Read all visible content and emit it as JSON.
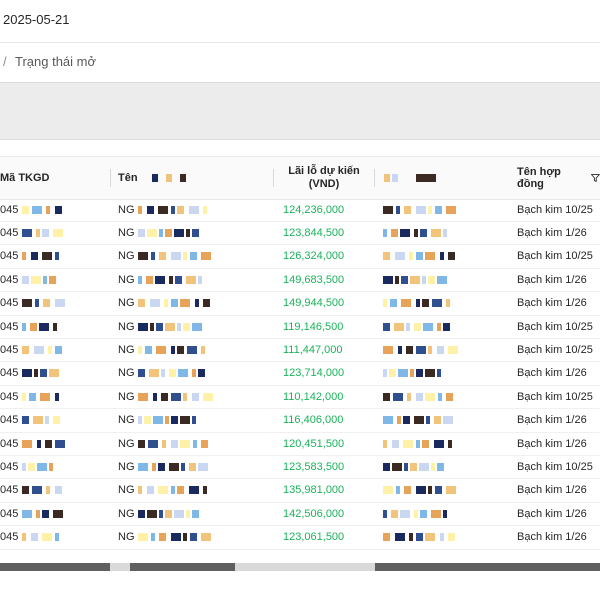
{
  "header": {
    "date": "2025-05-21"
  },
  "breadcrumb": {
    "separator": "/",
    "label": "Trạng thái mở"
  },
  "table": {
    "columns": {
      "code": "Mã TKGD",
      "name": "Tên",
      "pnl": "Lãi lỗ dự kiến (VND)",
      "contract": "Tên hợp đồng"
    },
    "rows": [
      {
        "code": "045",
        "name": "NG",
        "pnl": "124,236,000",
        "contract": "Bạch kim 10/25"
      },
      {
        "code": "045",
        "name": "NG",
        "pnl": "123,844,500",
        "contract": "Bạch kim 1/26"
      },
      {
        "code": "045",
        "name": "NG",
        "pnl": "126,324,000",
        "contract": "Bạch kim 10/25"
      },
      {
        "code": "045",
        "name": "NG",
        "pnl": "149,683,500",
        "contract": "Bạch kim 1/26"
      },
      {
        "code": "045",
        "name": "NG",
        "pnl": "149,944,500",
        "contract": "Bạch kim 1/26"
      },
      {
        "code": "045",
        "name": "NG",
        "pnl": "119,146,500",
        "contract": "Bạch kim 10/25"
      },
      {
        "code": "045",
        "name": "NG",
        "pnl": "111,447,000",
        "contract": "Bạch kim 10/25"
      },
      {
        "code": "045",
        "name": "NG",
        "pnl": "123,714,000",
        "contract": "Bạch kim 1/26"
      },
      {
        "code": "045",
        "name": "NG",
        "pnl": "110,142,000",
        "contract": "Bạch kim 10/25"
      },
      {
        "code": "045",
        "name": "NG",
        "pnl": "116,406,000",
        "contract": "Bạch kim 1/26"
      },
      {
        "code": "045",
        "name": "NG",
        "pnl": "120,451,500",
        "contract": "Bạch kim 1/26"
      },
      {
        "code": "045",
        "name": "NG",
        "pnl": "123,583,500",
        "contract": "Bạch kim 10/25"
      },
      {
        "code": "045",
        "name": "NG",
        "pnl": "135,981,000",
        "contract": "Bạch kim 1/26"
      },
      {
        "code": "045",
        "name": "NG",
        "pnl": "142,506,000",
        "contract": "Bạch kim 1/26"
      },
      {
        "code": "045",
        "name": "NG",
        "pnl": "123,061,500",
        "contract": "Bạch kim 1/26"
      }
    ]
  },
  "colors": {
    "profit": "#19b35a",
    "pixelation": [
      "#1b2a5e",
      "#f2c37a",
      "#7fb8e6",
      "#3b2a24",
      "#c9d8f0",
      "#e8a35b",
      "#2f4f8f",
      "#fff1a8"
    ]
  },
  "icons": {
    "filter": "filter-icon"
  }
}
